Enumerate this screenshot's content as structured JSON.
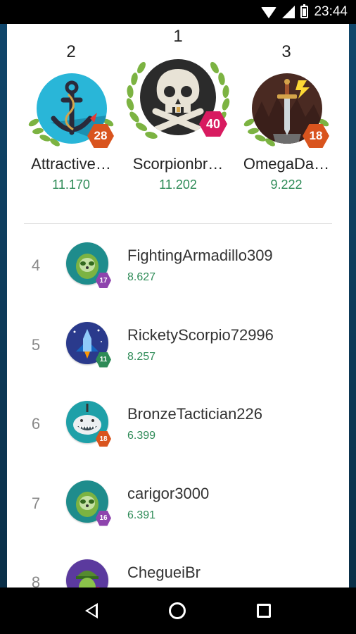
{
  "status_bar": {
    "time": "23:44",
    "icons": [
      "wifi-icon",
      "signal-icon",
      "battery-icon"
    ]
  },
  "podium": [
    {
      "rank": "2",
      "name": "Attractive…",
      "score": "11.170",
      "level": "28",
      "avatar": "anchor-avatar",
      "avatar_bg": "#29b6d8",
      "badge_color": "#d9541e"
    },
    {
      "rank": "1",
      "name": "Scorpionbr…",
      "score": "11.202",
      "level": "40",
      "avatar": "skull-avatar",
      "avatar_bg": "#2b2b2b",
      "badge_color": "#d81b60"
    },
    {
      "rank": "3",
      "name": "OmegaDa…",
      "score": "9.222",
      "level": "18",
      "avatar": "sword-avatar",
      "avatar_bg": "#4a2a22",
      "badge_color": "#d9541e"
    }
  ],
  "list": [
    {
      "rank": "4",
      "name": "FightingArmadillo309",
      "score": "8.627",
      "level": "17",
      "avatar": "sloth-avatar",
      "avatar_bg": "#1e8c8c",
      "badge_color": "#8e44ad"
    },
    {
      "rank": "5",
      "name": "RicketyScorpio72996",
      "score": "8.257",
      "level": "11",
      "avatar": "rocket-avatar",
      "avatar_bg": "#2a3a8c",
      "badge_color": "#2e8b57"
    },
    {
      "rank": "6",
      "name": "BronzeTactician226",
      "score": "6.399",
      "level": "18",
      "avatar": "shark-avatar",
      "avatar_bg": "#1ea0a8",
      "badge_color": "#d9541e"
    },
    {
      "rank": "7",
      "name": "carigor3000",
      "score": "6.391",
      "level": "16",
      "avatar": "sloth-avatar",
      "avatar_bg": "#1e8c8c",
      "badge_color": "#8e44ad"
    },
    {
      "rank": "8",
      "name": "ChegueiBr",
      "score": "",
      "level": "",
      "avatar": "soldier-avatar",
      "avatar_bg": "#5b3a9e",
      "badge_color": "#8e44ad"
    }
  ],
  "nav_bar": {
    "icons": [
      "back-icon",
      "home-icon",
      "recents-icon"
    ]
  },
  "colors": {
    "score_green": "#2e8b57",
    "laurel_green": "#7cb342"
  }
}
